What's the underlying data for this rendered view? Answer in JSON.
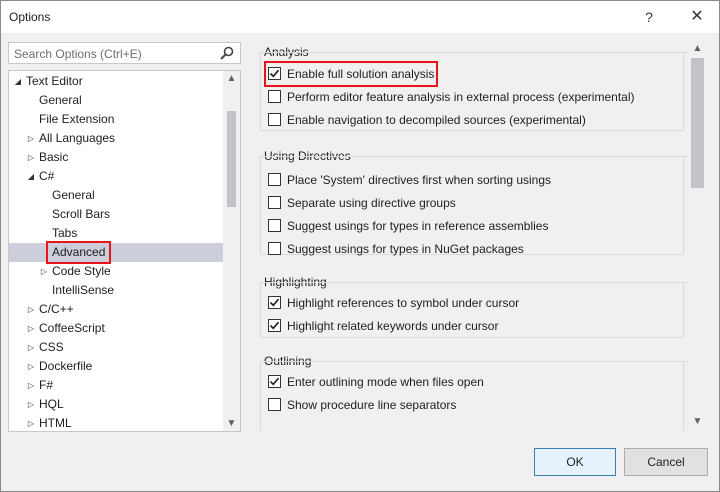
{
  "window": {
    "title": "Options",
    "help_glyph": "?",
    "close_glyph": "✕"
  },
  "search": {
    "placeholder": "Search Options (Ctrl+E)"
  },
  "tree": {
    "items": [
      {
        "label": "Text Editor",
        "expander": "◢",
        "selected": false
      },
      {
        "label": "General",
        "expander": "",
        "selected": false
      },
      {
        "label": "File Extension",
        "expander": "",
        "selected": false
      },
      {
        "label": "All Languages",
        "expander": "▷",
        "selected": false
      },
      {
        "label": "Basic",
        "expander": "▷",
        "selected": false
      },
      {
        "label": "C#",
        "expander": "◢",
        "selected": false
      },
      {
        "label": "General",
        "expander": "",
        "selected": false
      },
      {
        "label": "Scroll Bars",
        "expander": "",
        "selected": false
      },
      {
        "label": "Tabs",
        "expander": "",
        "selected": false
      },
      {
        "label": "Advanced",
        "expander": "",
        "selected": true
      },
      {
        "label": "Code Style",
        "expander": "▷",
        "selected": false
      },
      {
        "label": "IntelliSense",
        "expander": "",
        "selected": false
      },
      {
        "label": "C/C++",
        "expander": "▷",
        "selected": false
      },
      {
        "label": "CoffeeScript",
        "expander": "▷",
        "selected": false
      },
      {
        "label": "CSS",
        "expander": "▷",
        "selected": false
      },
      {
        "label": "Dockerfile",
        "expander": "▷",
        "selected": false
      },
      {
        "label": "F#",
        "expander": "▷",
        "selected": false
      },
      {
        "label": "HQL",
        "expander": "▷",
        "selected": false
      },
      {
        "label": "HTML",
        "expander": "▷",
        "selected": false
      }
    ]
  },
  "groups": [
    {
      "title": "Analysis",
      "options": [
        {
          "label": "Enable full solution analysis",
          "checked": true
        },
        {
          "label": "Perform editor feature analysis in external process (experimental)",
          "checked": false
        },
        {
          "label": "Enable navigation to decompiled sources (experimental)",
          "checked": false
        }
      ]
    },
    {
      "title": "Using Directives",
      "options": [
        {
          "label": "Place 'System' directives first when sorting usings",
          "checked": false
        },
        {
          "label": "Separate using directive groups",
          "checked": false
        },
        {
          "label": "Suggest usings for types in reference assemblies",
          "checked": false
        },
        {
          "label": "Suggest usings for types in NuGet packages",
          "checked": false
        }
      ]
    },
    {
      "title": "Highlighting",
      "options": [
        {
          "label": "Highlight references to symbol under cursor",
          "checked": true
        },
        {
          "label": "Highlight related keywords under cursor",
          "checked": true
        }
      ]
    },
    {
      "title": "Outlining",
      "options": [
        {
          "label": "Enter outlining mode when files open",
          "checked": true
        },
        {
          "label": "Show procedure line separators",
          "checked": false
        }
      ]
    }
  ],
  "buttons": {
    "ok": "OK",
    "cancel": "Cancel"
  },
  "colors": {
    "selection": "#cccedb",
    "highlight_box": "#e8141b",
    "ok_border": "#3c7fb1"
  }
}
